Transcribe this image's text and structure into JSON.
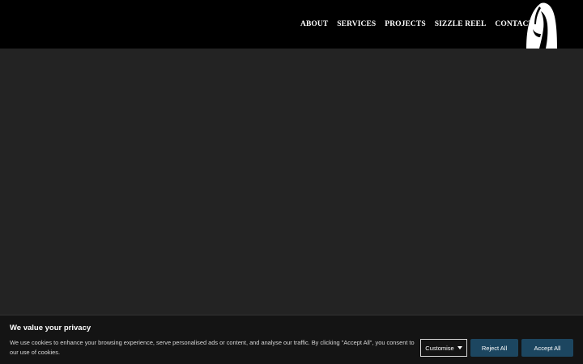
{
  "nav": {
    "items": [
      {
        "label": "ABOUT"
      },
      {
        "label": "SERVICES"
      },
      {
        "label": "PROJECTS"
      },
      {
        "label": "SIZZLE REEL"
      },
      {
        "label": "CONTACT"
      }
    ]
  },
  "logo": {
    "icon": "hooded-reaper-logo-icon"
  },
  "colors": {
    "header_bg": "#000000",
    "page_bg": "#232323",
    "banner_bg": "#141414",
    "button_accent": "#1c4660"
  },
  "cookie": {
    "title": "We value your privacy",
    "text": "We use cookies to enhance your browsing experience, serve personalised ads or content, and analyse our traffic. By clicking \"Accept All\", you consent to our use of cookies.",
    "customise_label": "Customise",
    "reject_label": "Reject All",
    "accept_label": "Accept All"
  }
}
